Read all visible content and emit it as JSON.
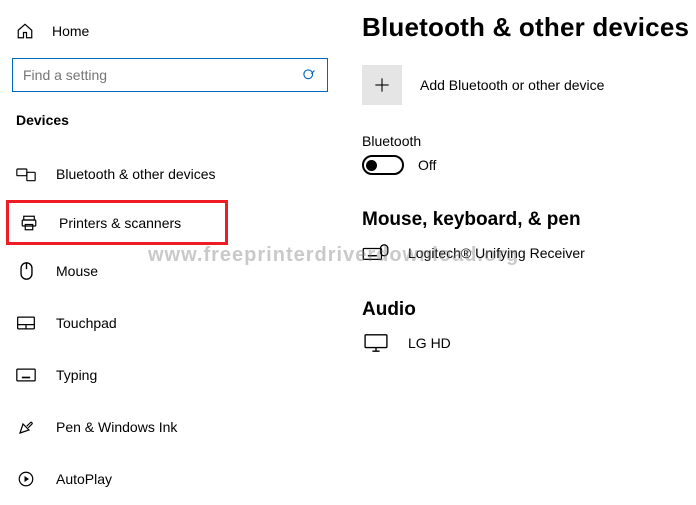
{
  "sidebar": {
    "home_label": "Home",
    "search_placeholder": "Find a setting",
    "section_title": "Devices",
    "items": [
      {
        "label": "Bluetooth & other devices"
      },
      {
        "label": "Printers & scanners"
      },
      {
        "label": "Mouse"
      },
      {
        "label": "Touchpad"
      },
      {
        "label": "Typing"
      },
      {
        "label": "Pen & Windows Ink"
      },
      {
        "label": "AutoPlay"
      }
    ]
  },
  "main": {
    "title": "Bluetooth & other devices",
    "add_label": "Add Bluetooth or other device",
    "bluetooth": {
      "label": "Bluetooth",
      "state": "Off"
    },
    "section_mouse": {
      "title": "Mouse, keyboard, & pen",
      "device": "Logitech® Unifying Receiver"
    },
    "section_audio": {
      "title": "Audio",
      "device": "LG HD"
    }
  },
  "watermark": "www.freeprinterdriverdownload.org"
}
